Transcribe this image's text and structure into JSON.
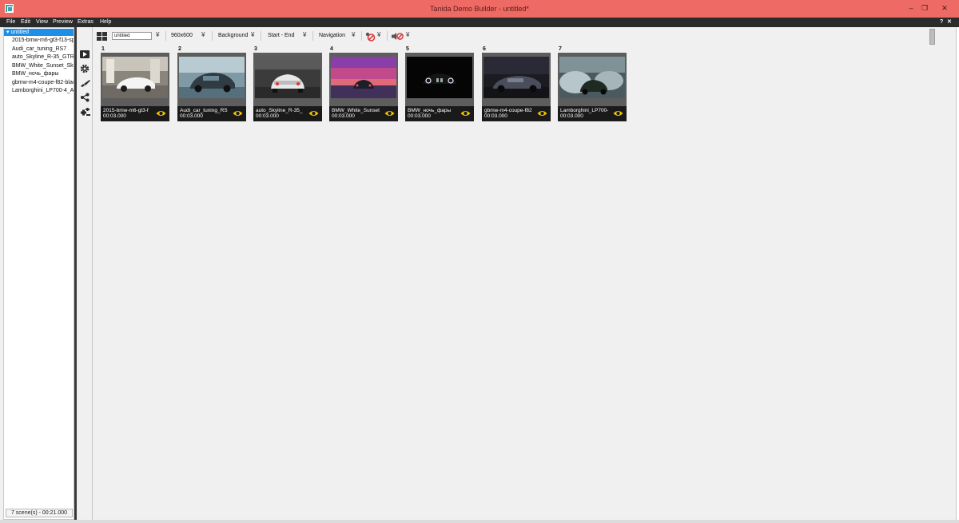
{
  "window": {
    "title": "Tanida Demo Builder - untitled*",
    "minimize": "‒",
    "restore": "❐",
    "close": "✕"
  },
  "menu": {
    "items": [
      "File",
      "Edit",
      "View",
      "Preview",
      "Extras",
      "Help"
    ],
    "help_q": "?",
    "close_x": "✕"
  },
  "tree": {
    "root_arrow": "▾",
    "root_label": "untitled",
    "items": [
      "2015-bmw-m6-gt3-f13-sp",
      "Audi_car_tuning_RS7",
      "auto_Skyline_R-35_GTR_",
      "BMW_White_Sunset_Sky",
      "BMW_ночь_фары",
      "gbmw-m4-coupe-f82-blac",
      "Lamborghini_LP700-4_Av"
    ],
    "status": "7 scene(s) - 00:21.000"
  },
  "toolbar": {
    "project_name": "untitled",
    "resolution": "960x600",
    "background": "Background",
    "range": "Start - End",
    "navigation": "Navigation",
    "chevron": "¥"
  },
  "scenes": [
    {
      "number": "1",
      "name": "2015-bmw-m6-gt3-f",
      "duration": "00:03.000"
    },
    {
      "number": "2",
      "name": "Audi_car_tuning_RS",
      "duration": "00:03.000"
    },
    {
      "number": "3",
      "name": "auto_Skyline_R-35_",
      "duration": "00:03.000"
    },
    {
      "number": "4",
      "name": "BMW_White_Sunset",
      "duration": "00:03.000"
    },
    {
      "number": "5",
      "name": "BMW_ночь_фары",
      "duration": "00:03.000"
    },
    {
      "number": "6",
      "name": "gbmw-m4-coupe-f82",
      "duration": "00:03.000"
    },
    {
      "number": "7",
      "name": "Lamborghini_LP700-",
      "duration": "00:03.000"
    }
  ],
  "colors": {
    "titlebar": "#ee6a64",
    "selection": "#1e8fe6",
    "eye_icon": "#f5c400",
    "no_audio": "#d93a3a"
  }
}
